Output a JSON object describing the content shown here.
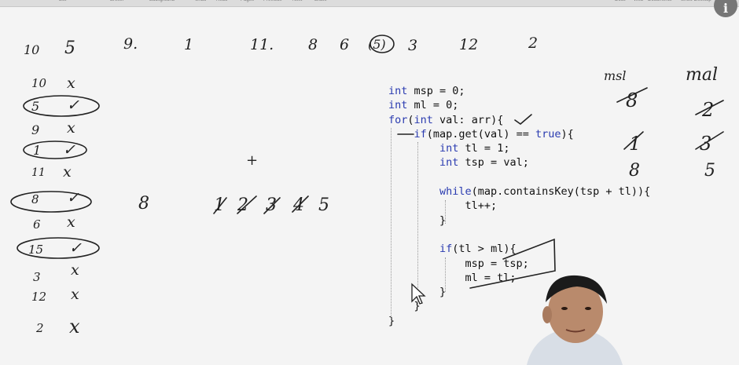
{
  "toolbar": {
    "items": [
      "Lite",
      "Ereser",
      "Background",
      "Undo",
      "Redo",
      "Pages",
      "Previous",
      "Next",
      "Erase",
      "Docs",
      "Web",
      "Documents",
      "Show Desktop"
    ]
  },
  "info_icon_glyph": "i",
  "board": {
    "top_row": [
      "10",
      "5",
      "9.",
      "1",
      "11.",
      "8",
      "6",
      "(5)",
      "3",
      "12",
      "2"
    ],
    "left_column": [
      {
        "num": "10",
        "mark": "x",
        "circled": false
      },
      {
        "num": "5",
        "mark": "✓",
        "circled": true
      },
      {
        "num": "9",
        "mark": "x",
        "circled": false
      },
      {
        "num": "1",
        "mark": "✓",
        "circled": true
      },
      {
        "num": "11",
        "mark": "x",
        "circled": false
      },
      {
        "num": "8",
        "mark": "✓",
        "circled": true
      },
      {
        "num": "6",
        "mark": "x",
        "circled": false
      },
      {
        "num": "15",
        "mark": "✓",
        "circled": true
      },
      {
        "num": "3",
        "mark": "x",
        "circled": false
      },
      {
        "num": "12",
        "mark": "x",
        "circled": false
      },
      {
        "num": "2",
        "mark": "x",
        "circled": false
      }
    ],
    "middle_number": "8",
    "plus_sign": "+",
    "struck_sequence": [
      "1",
      "2",
      "3",
      "4",
      "5"
    ],
    "right_headers": {
      "left": "msl",
      "right": "mal"
    },
    "right_left_col": [
      "8",
      "1",
      "8"
    ],
    "right_right_col": [
      "2",
      "3",
      "5"
    ]
  },
  "code": {
    "lines": [
      [
        {
          "t": "int",
          "k": 1
        },
        {
          "t": " msp = 0;"
        }
      ],
      [
        {
          "t": "int",
          "k": 1
        },
        {
          "t": " ml = 0;"
        }
      ],
      [
        {
          "t": "for",
          "k": 1
        },
        {
          "t": "("
        },
        {
          "t": "int",
          "k": 1
        },
        {
          "t": " val: arr){"
        }
      ],
      [
        {
          "t": "    "
        },
        {
          "t": "if",
          "k": 1
        },
        {
          "t": "(map.get(val) == "
        },
        {
          "t": "true",
          "k": 1
        },
        {
          "t": "){"
        }
      ],
      [
        {
          "t": "        "
        },
        {
          "t": "int",
          "k": 1
        },
        {
          "t": " tl = 1;"
        }
      ],
      [
        {
          "t": "        "
        },
        {
          "t": "int",
          "k": 1
        },
        {
          "t": " tsp = val;"
        }
      ],
      [
        {
          "t": ""
        }
      ],
      [
        {
          "t": "        "
        },
        {
          "t": "while",
          "k": 1
        },
        {
          "t": "(map.containsKey(tsp + tl)){"
        }
      ],
      [
        {
          "t": "            tl++;"
        }
      ],
      [
        {
          "t": "        }"
        }
      ],
      [
        {
          "t": ""
        }
      ],
      [
        {
          "t": "        "
        },
        {
          "t": "if",
          "k": 1
        },
        {
          "t": "(tl > ml){"
        }
      ],
      [
        {
          "t": "            msp = tsp;"
        }
      ],
      [
        {
          "t": "            ml = tl;"
        }
      ],
      [
        {
          "t": "        }"
        }
      ],
      [
        {
          "t": "    }"
        }
      ],
      [
        {
          "t": "}"
        }
      ]
    ]
  },
  "colors": {
    "keyword": "#2a3bb0",
    "ink": "#222222",
    "board": "#f4f4f4"
  }
}
